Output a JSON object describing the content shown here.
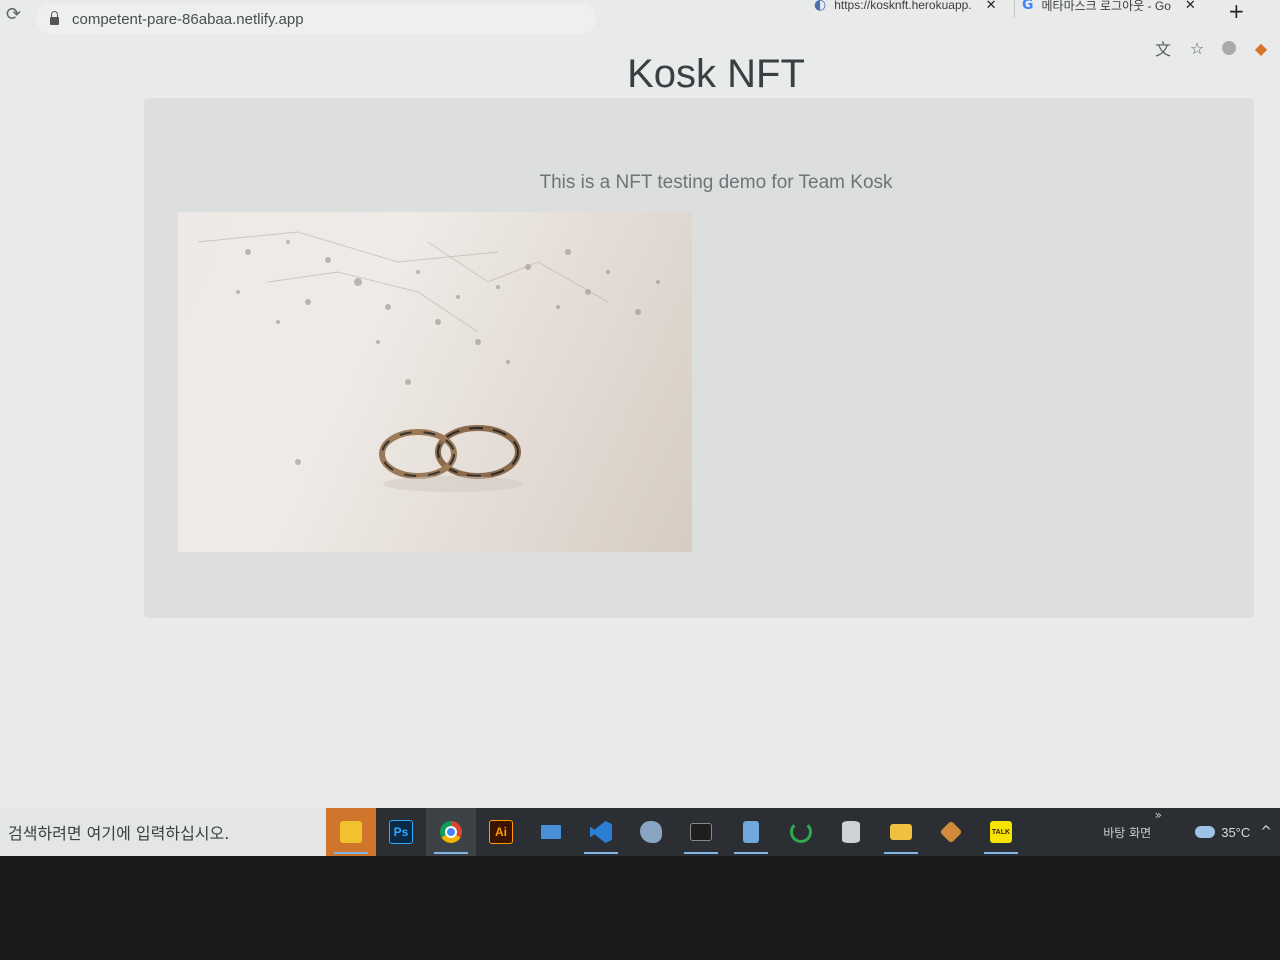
{
  "browser": {
    "url": "competent-pare-86abaa.netlify.app",
    "tabs": [
      {
        "label": "https://kosknft.herokuapp.",
        "close": "✕"
      },
      {
        "label": "메타마스크 로그아웃 - Go",
        "close": "✕"
      }
    ],
    "new_tab": "+"
  },
  "page": {
    "title": "Kosk NFT",
    "tagline": "This is a NFT testing demo for Team Kosk"
  },
  "taskbar": {
    "search_placeholder": "검색하려면 여기에 입력하십시오.",
    "apps": [
      {
        "name": "sticky-notes",
        "glyph": "",
        "color": "#f2c12e"
      },
      {
        "name": "photoshop",
        "glyph": "Ps",
        "color": "#0a2a46"
      },
      {
        "name": "chrome",
        "glyph": "",
        "color": "#dd4b39"
      },
      {
        "name": "illustrator",
        "glyph": "Ai",
        "color": "#3a1400"
      },
      {
        "name": "this-pc",
        "glyph": "",
        "color": "#4a90d9"
      },
      {
        "name": "vscode",
        "glyph": "",
        "color": "#2a7fd4"
      },
      {
        "name": "paint",
        "glyph": "",
        "color": "#8aa5c4"
      },
      {
        "name": "terminal",
        "glyph": "",
        "color": "#444"
      },
      {
        "name": "notepad",
        "glyph": "",
        "color": "#6fa8dc"
      },
      {
        "name": "loader",
        "glyph": "",
        "color": "#2fa84f"
      },
      {
        "name": "database",
        "glyph": "",
        "color": "#cccccc"
      },
      {
        "name": "file-explorer",
        "glyph": "",
        "color": "#f0c040"
      },
      {
        "name": "box-app",
        "glyph": "",
        "color": "#d08a3a"
      },
      {
        "name": "kakaotalk",
        "glyph": "TALK",
        "color": "#f7e300"
      }
    ],
    "desktop_label": "바탕 화면",
    "more": "»",
    "temperature": "35°C",
    "tray_chevron": "^"
  }
}
